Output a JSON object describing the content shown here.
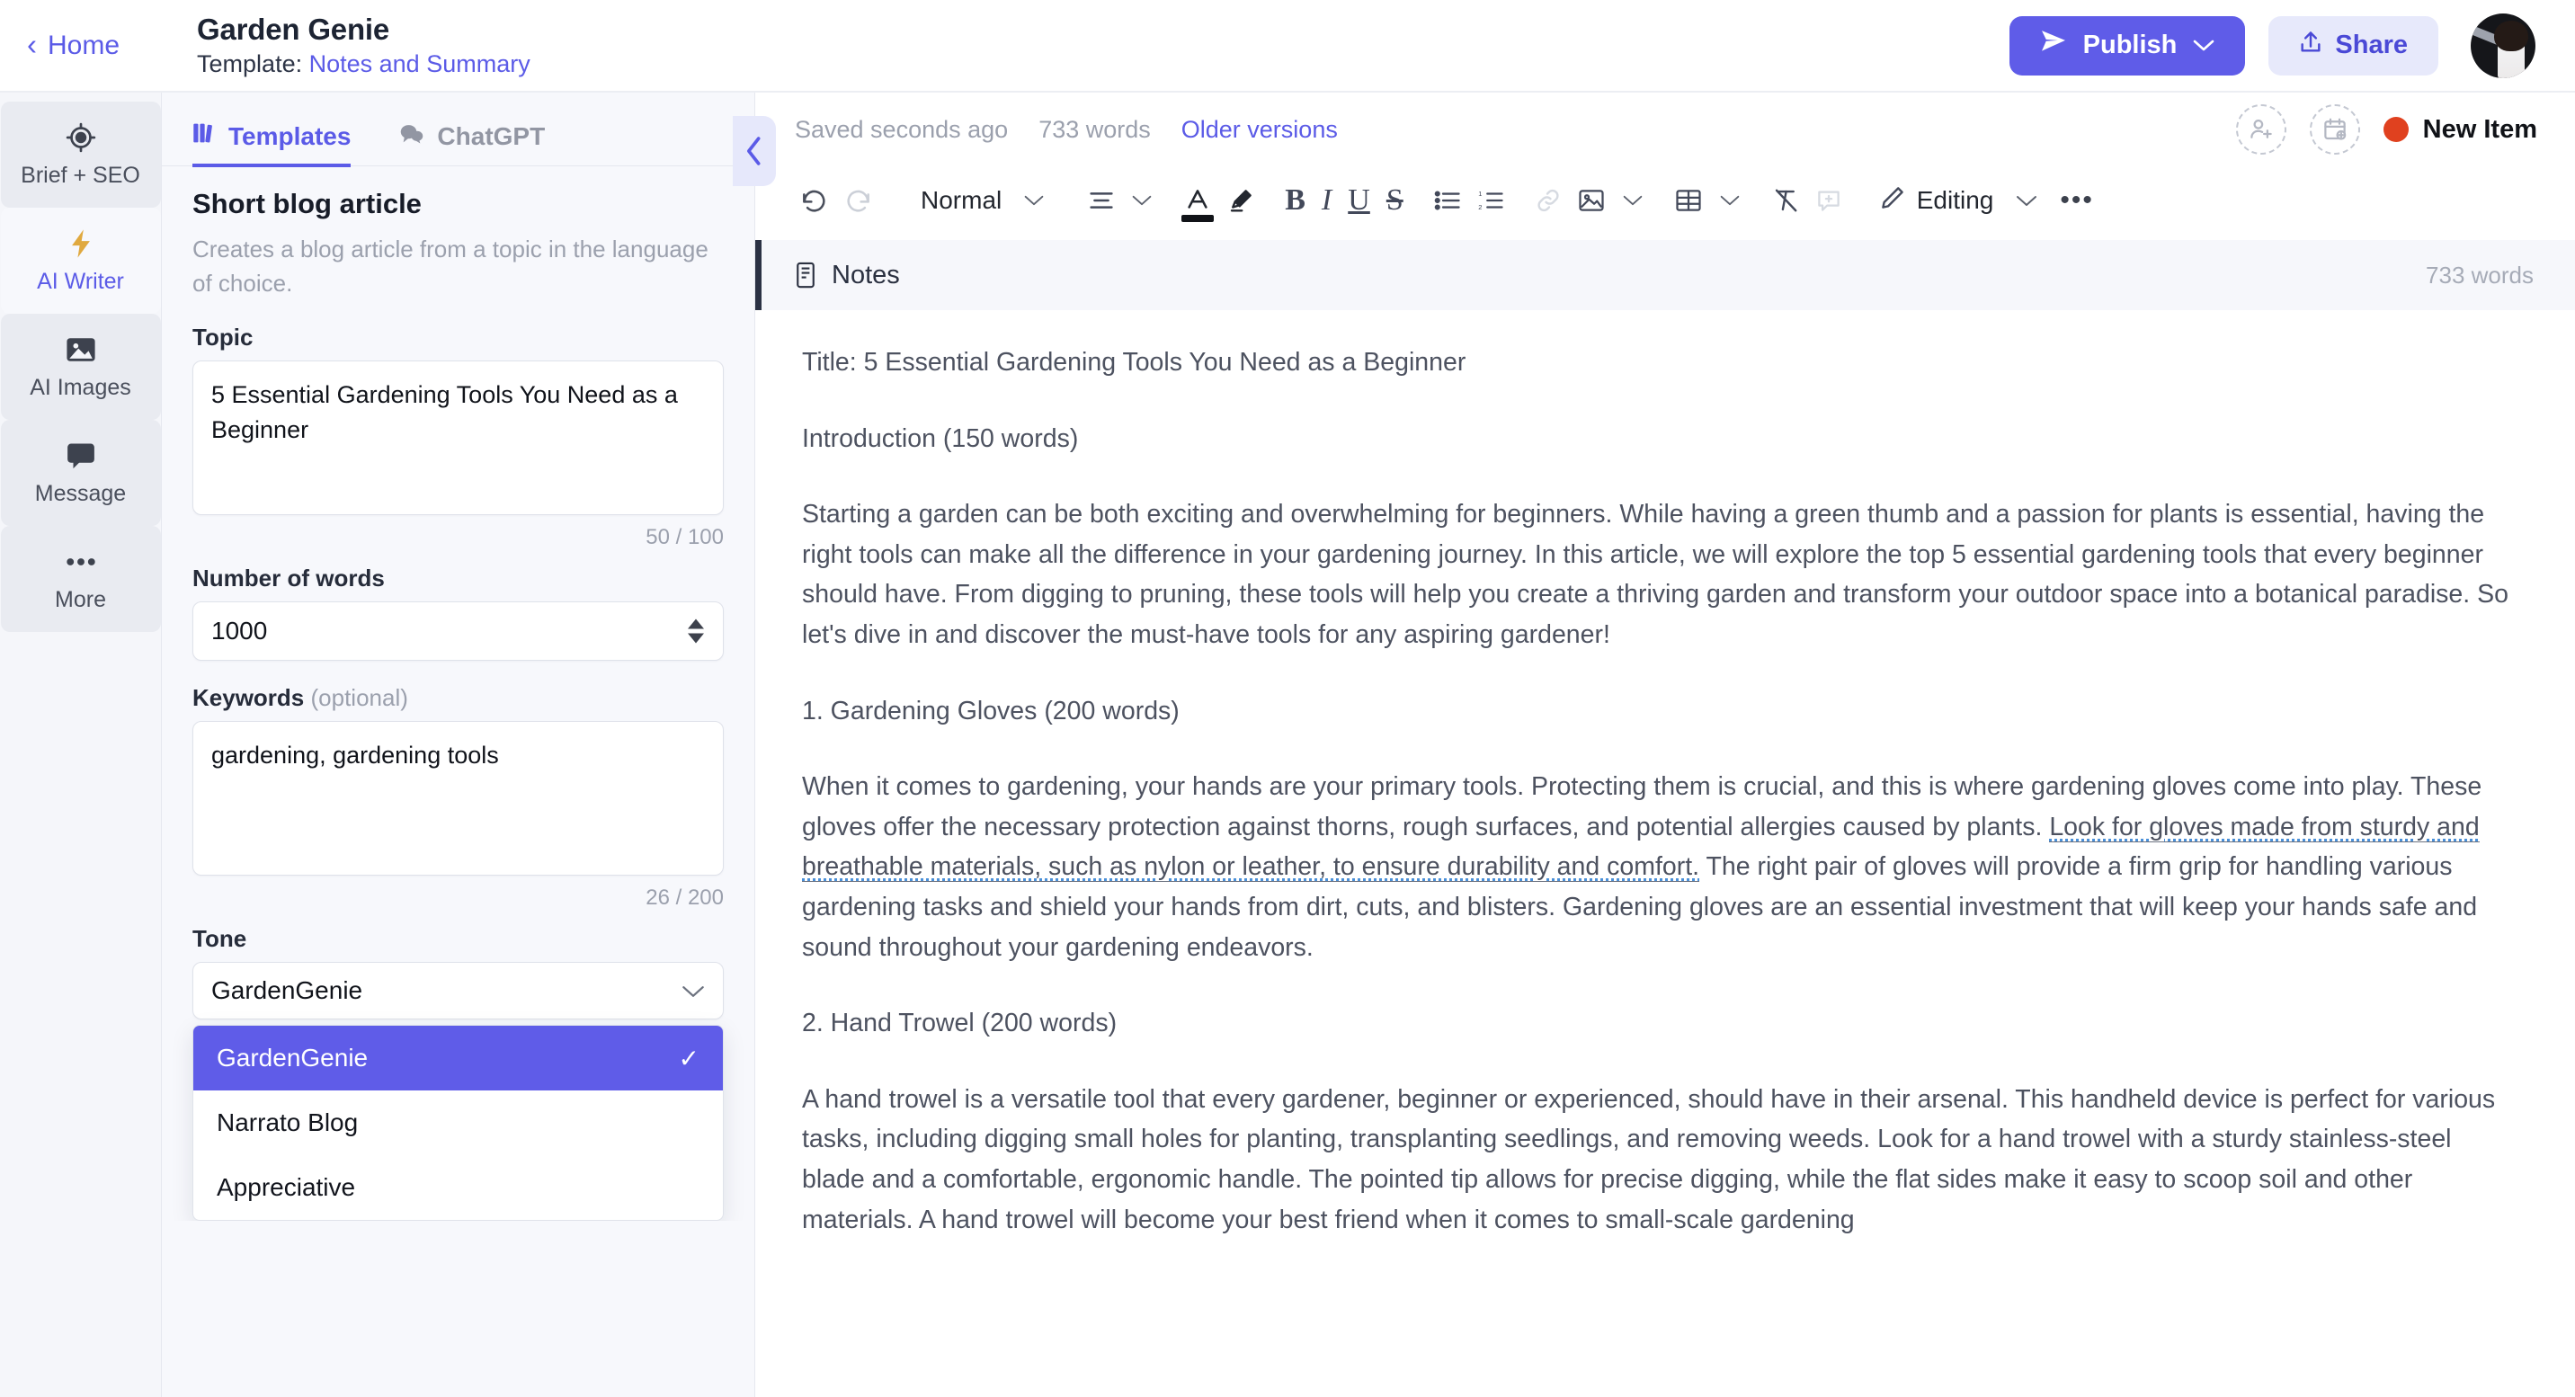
{
  "topbar": {
    "home_label": "Home",
    "doc_title": "Garden Genie",
    "template_prefix": "Template:",
    "template_name": "Notes and Summary",
    "publish_label": "Publish",
    "publish_caret": "⌄",
    "share_label": "Share"
  },
  "rail": {
    "items": [
      {
        "label": "Brief + SEO",
        "icon": "target-icon"
      },
      {
        "label": "AI Writer",
        "icon": "lightning-icon"
      },
      {
        "label": "AI Images",
        "icon": "image-icon"
      },
      {
        "label": "Message",
        "icon": "chat-bubble-icon"
      },
      {
        "label": "More",
        "icon": "ellipsis-icon"
      }
    ]
  },
  "template_panel": {
    "tabs": [
      {
        "label": "Templates",
        "icon": "templates-icon",
        "active": true
      },
      {
        "label": "ChatGPT",
        "icon": "chat-icon",
        "active": false
      }
    ],
    "heading": "Short blog article",
    "description": "Creates a blog article from a topic in the language of choice.",
    "topic": {
      "label": "Topic",
      "value": "5 Essential Gardening Tools You Need as a Beginner",
      "placeholder": "Enter a topic",
      "counter": "50 / 100"
    },
    "number_of_words": {
      "label": "Number of words",
      "value": "1000"
    },
    "keywords": {
      "label": "Keywords",
      "optional": "(optional)",
      "value": "gardening, gardening tools",
      "placeholder": "Enter keywords",
      "counter": "26 / 200"
    },
    "tone": {
      "label": "Tone",
      "selected": "GardenGenie",
      "caret": "⌄",
      "options": [
        {
          "label": "GardenGenie",
          "selected": true,
          "check": "✓"
        },
        {
          "label": "Narrato Blog",
          "selected": false,
          "check": ""
        },
        {
          "label": "Appreciative",
          "selected": false,
          "check": ""
        }
      ]
    },
    "collapse_icon": "‹"
  },
  "editor": {
    "status": {
      "saved": "Saved seconds ago",
      "words": "733 words",
      "older_versions": "Older versions"
    },
    "actions": {
      "add_person_icon": "add-person-icon",
      "schedule_icon": "add-calendar-icon",
      "new_item_label": "New Item",
      "new_item_dot_color": "#e0411f"
    },
    "toolbar": {
      "undo": "undo-icon",
      "redo": "redo-icon",
      "style": "Normal",
      "style_caret": "⌄",
      "align": "align-icon",
      "align_caret": "⌄",
      "text_color": "text-color-icon",
      "highlight": "highlighter-icon",
      "bold": "B",
      "italic": "I",
      "underline": "U",
      "strikethrough": "S",
      "bullet_list": "bullet-list-icon",
      "numbered_list": "numbered-list-icon",
      "link": "link-icon",
      "image": "image-icon",
      "image_caret": "⌄",
      "table": "table-icon",
      "table_caret": "⌄",
      "clear_format": "clear-format-icon",
      "comment": "add-comment-icon",
      "mode_label": "Editing",
      "mode_caret": "⌄",
      "more": "•••"
    },
    "notes_block": {
      "title": "Notes",
      "words": "733 words",
      "icon": "notes-icon"
    },
    "content": {
      "title_line": "Title: 5 Essential Gardening Tools You Need as a Beginner",
      "intro_heading": "Introduction (150 words)",
      "intro_body": "Starting a garden can be both exciting and overwhelming for beginners. While having a green thumb and a passion for plants is essential, having the right tools can make all the difference in your gardening journey. In this article, we will explore the top 5 essential gardening tools that every beginner should have. From digging to pruning, these tools will help you create a thriving garden and transform your outdoor space into a botanical paradise. So let's dive in and discover the must-have tools for any aspiring gardener!",
      "section1_heading": "1. Gardening Gloves (200 words)",
      "section1_part1": "When it comes to gardening, your hands are your primary tools. Protecting them is crucial, and this is where gardening gloves come into play. These gloves offer the necessary protection against thorns, rough surfaces, and potential allergies caused by plants. ",
      "section1_suggestion": "Look for gloves made from sturdy and breathable materials, such as nylon or leather, to ensure durability and comfort.",
      "section1_part2": " The right pair of gloves will provide a firm grip for handling various gardening tasks and shield your hands from dirt, cuts, and blisters. Gardening gloves are an essential investment that will keep your hands safe and sound throughout your gardening endeavors.",
      "section2_heading": "2. Hand Trowel (200 words)",
      "section2_body": "A hand trowel is a versatile tool that every gardener, beginner or experienced, should have in their arsenal. This handheld device is perfect for various tasks, including digging small holes for planting, transplanting seedlings, and removing weeds. Look for a hand trowel with a sturdy stainless-steel blade and a comfortable, ergonomic handle. The pointed tip allows for precise digging, while the flat sides make it easy to scoop soil and other materials. A hand trowel will become your best friend when it comes to small-scale gardening"
    }
  },
  "colors": {
    "accent": "#5b5be7",
    "accent_button": "#5f5ce8",
    "share_bg": "#e7e9fb",
    "panel_bg": "#f7f8fc",
    "rail_bg": "#f5f6fa",
    "new_item_dot": "#e0411f",
    "suggestion_underline": "#4a90d9"
  }
}
